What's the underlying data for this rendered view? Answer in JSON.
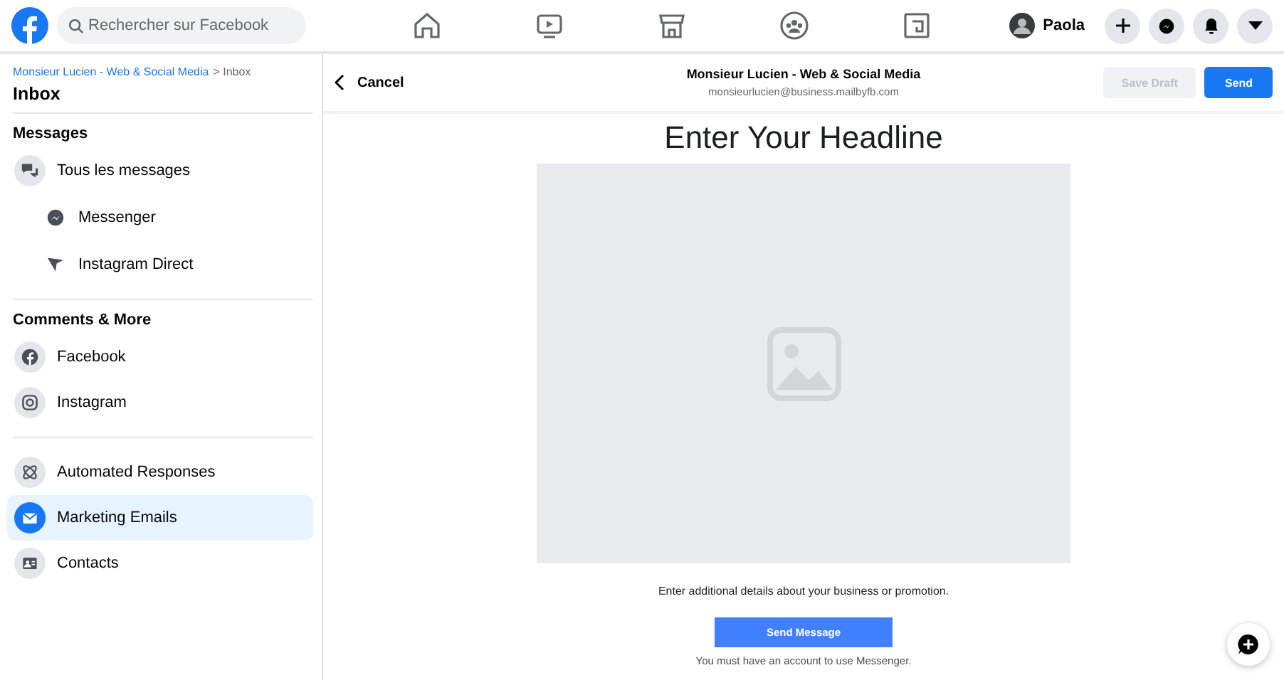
{
  "topbar": {
    "search": {
      "placeholder": "Rechercher sur Facebook"
    },
    "profile": {
      "name": "Paola"
    }
  },
  "sidebar": {
    "breadcrumb": {
      "link": "Monsieur Lucien - Web & Social Media",
      "current": "> Inbox"
    },
    "title": "Inbox",
    "sections": [
      {
        "title": "Messages",
        "items": [
          {
            "label": "Tous les messages",
            "selected": false,
            "children": [
              {
                "label": "Messenger",
                "selected": false
              },
              {
                "label": "Instagram Direct",
                "selected": false
              }
            ]
          }
        ]
      },
      {
        "title": "Comments & More",
        "items": [
          {
            "label": "Facebook",
            "selected": false
          },
          {
            "label": "Instagram",
            "selected": false
          }
        ]
      },
      {
        "items": [
          {
            "label": "Automated Responses",
            "selected": false
          },
          {
            "label": "Marketing Emails",
            "selected": true
          },
          {
            "label": "Contacts",
            "selected": false
          }
        ]
      }
    ]
  },
  "composer": {
    "cancel": "Cancel",
    "page_name": "Monsieur Lucien - Web & Social Media",
    "email": "monsieurlucien@business.mailbyfb.com",
    "buttons": [
      {
        "label": "Save Draft",
        "disabled": true
      },
      {
        "label": "Send",
        "disabled": false
      }
    ]
  },
  "email": {
    "headline": "Enter Your Headline",
    "image": {
      "kind": "placeholder"
    },
    "details": "Enter additional details about your business or promotion.",
    "button": "Send Message",
    "note": "You must have an account to use Messenger."
  }
}
